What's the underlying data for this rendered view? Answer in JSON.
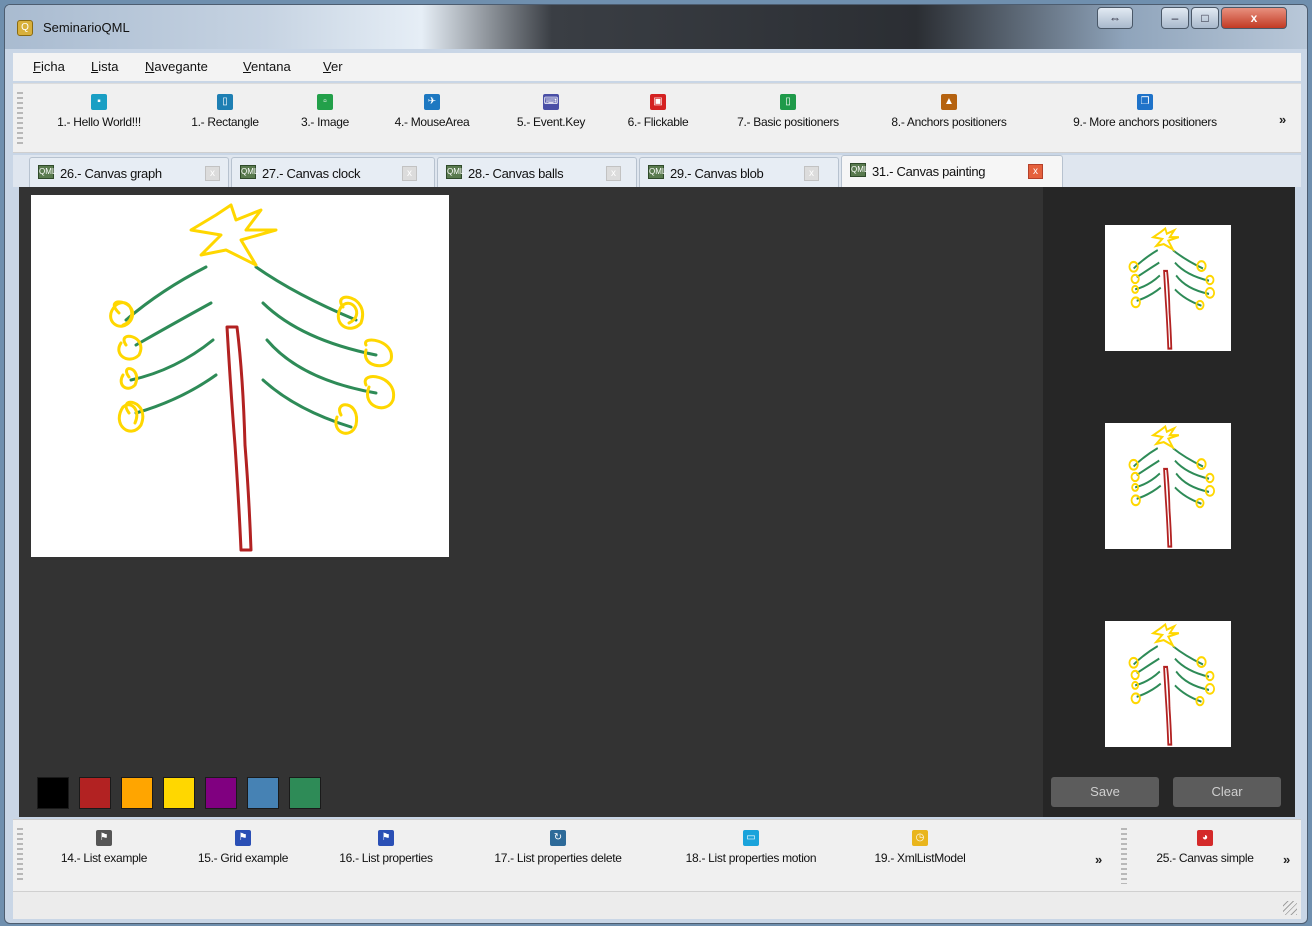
{
  "window": {
    "title": "SeminarioQML"
  },
  "title_buttons": {
    "restore": "⇔",
    "minimize": "–",
    "maximize": "□",
    "close": "x"
  },
  "menu": [
    {
      "first": "F",
      "rest": "icha"
    },
    {
      "first": "L",
      "rest": "ista"
    },
    {
      "first": "N",
      "rest": "avegante"
    },
    {
      "first": "V",
      "rest": "entana"
    },
    {
      "first": "V",
      "rest": "er"
    }
  ],
  "toolbar": {
    "items": [
      {
        "label": "1.- Hello World!!!",
        "icon": "suitcase-icon",
        "color": "#1a9fc4"
      },
      {
        "label": "1.- Rectangle",
        "icon": "phone-icon",
        "color": "#1e7fb3"
      },
      {
        "label": "3.- Image",
        "icon": "image-icon",
        "color": "#23a04a"
      },
      {
        "label": "4.- MouseArea",
        "icon": "plane-icon",
        "color": "#1d78c1"
      },
      {
        "label": "5.- Event.Key",
        "icon": "keyboard-icon",
        "color": "#4a4fa6"
      },
      {
        "label": "6.- Flickable",
        "icon": "train-icon",
        "color": "#d42121"
      },
      {
        "label": "7.- Basic positioners",
        "icon": "document-icon",
        "color": "#1f9a4a"
      },
      {
        "label": "8.- Anchors positioners",
        "icon": "building-icon",
        "color": "#b5620f"
      },
      {
        "label": "9.- More anchors positioners",
        "icon": "pages-icon",
        "color": "#1f73c9"
      }
    ],
    "more": "»"
  },
  "tabs": [
    {
      "label": "26.- Canvas graph",
      "close": "x"
    },
    {
      "label": "27.- Canvas clock",
      "close": "x"
    },
    {
      "label": "28.- Canvas balls",
      "close": "x"
    },
    {
      "label": "29.- Canvas blob",
      "close": "x"
    },
    {
      "label": "31.- Canvas painting",
      "close": "x",
      "active": true
    }
  ],
  "painting": {
    "palette": [
      "#000000",
      "#b22222",
      "#ffa500",
      "#ffd700",
      "#800080",
      "#4682b4",
      "#2e8b57"
    ],
    "save_label": "Save",
    "clear_label": "Clear"
  },
  "bottom_toolbar": {
    "items": [
      {
        "label": "14.- List example",
        "icon": "flag-icon",
        "color": "#555555"
      },
      {
        "label": "15.- Grid example",
        "icon": "flag-icon",
        "color": "#2a4fb5"
      },
      {
        "label": "16.- List properties",
        "icon": "flag-icon",
        "color": "#2a4fb5"
      },
      {
        "label": "17.- List properties delete",
        "icon": "refresh-icon",
        "color": "#2d6a99"
      },
      {
        "label": "18.- List properties motion",
        "icon": "window-icon",
        "color": "#1aa3db"
      },
      {
        "label": "19.- XmlListModel",
        "icon": "clock-icon",
        "color": "#e9b51c"
      }
    ],
    "more": "»",
    "extra": {
      "label": "25.- Canvas simple",
      "icon": "chart-icon",
      "color": "#d42a2a"
    },
    "extra_more": "»"
  }
}
